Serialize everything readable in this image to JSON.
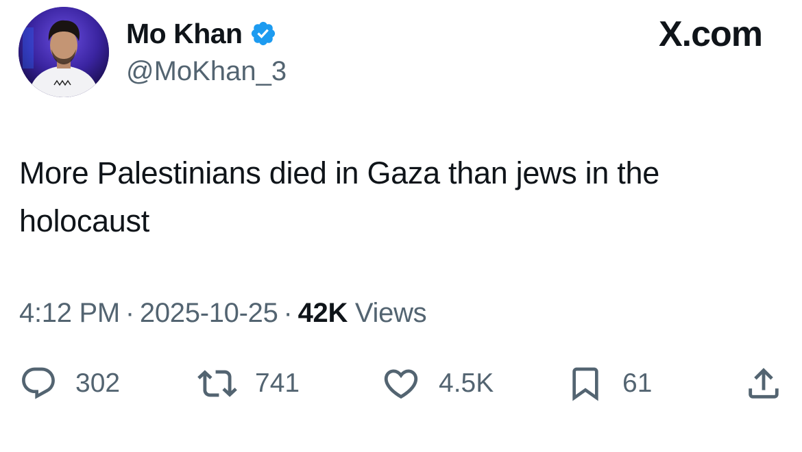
{
  "author": {
    "display_name": "Mo Khan",
    "handle": "@MoKhan_3",
    "verified": true,
    "verified_color": "#1d9bf0"
  },
  "brand": "X.com",
  "tweet": {
    "text": "More Palestinians died in Gaza than jews in the holocaust"
  },
  "meta": {
    "time": "4:12 PM",
    "separator": "·",
    "date": "2025-10-25",
    "views_count": "42K",
    "views_label": "Views"
  },
  "actions": {
    "reply": {
      "icon": "reply-icon",
      "count": "302"
    },
    "retweet": {
      "icon": "retweet-icon",
      "count": "741"
    },
    "like": {
      "icon": "heart-icon",
      "count": "4.5K"
    },
    "bookmark": {
      "icon": "bookmark-icon",
      "count": "61"
    },
    "share": {
      "icon": "share-icon"
    }
  },
  "colors": {
    "text_primary": "#0f1419",
    "text_secondary": "#536471",
    "accent": "#1d9bf0"
  }
}
